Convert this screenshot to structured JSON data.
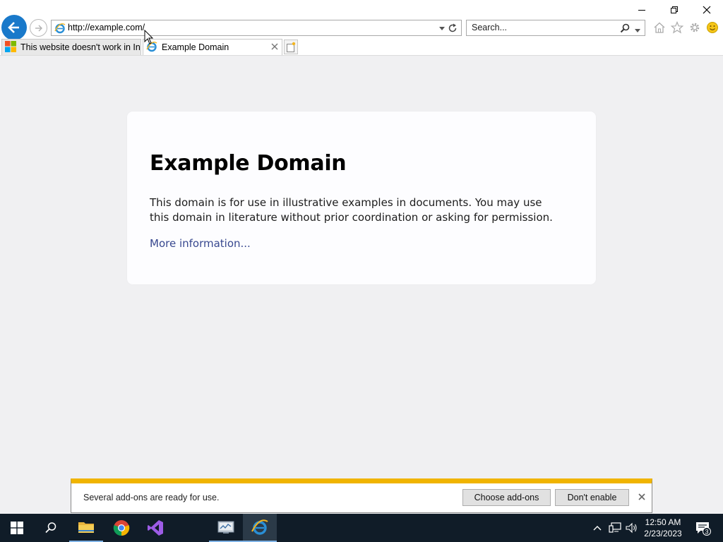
{
  "browser": {
    "address": "http://example.com/",
    "search_placeholder": "Search...",
    "tabs": [
      {
        "label": "This website doesn't work in In..."
      },
      {
        "label": "Example Domain"
      }
    ]
  },
  "page": {
    "heading": "Example Domain",
    "paragraph": "This domain is for use in illustrative examples in documents. You may use this domain in literature without prior coordination or asking for permission.",
    "link": "More information..."
  },
  "notification": {
    "message": "Several add-ons are ready for use.",
    "choose_label": "Choose add-ons",
    "dont_enable_label": "Don't enable"
  },
  "taskbar": {
    "time": "12:50 AM",
    "date": "2/23/2023",
    "notification_count": "3"
  },
  "colors": {
    "back_button": "#1979ca",
    "notification_accent": "#f0b400",
    "link": "#38488f",
    "taskbar": "#101c28"
  },
  "icons": [
    "back-arrow-icon",
    "forward-arrow-icon",
    "ie-logo-icon",
    "refresh-icon",
    "search-icon",
    "home-icon",
    "favorites-star-icon",
    "gear-icon",
    "smiley-icon",
    "windows-logo-icon",
    "chrome-icon",
    "visual-studio-icon",
    "folder-icon",
    "network-icon",
    "speaker-icon",
    "action-center-icon"
  ]
}
